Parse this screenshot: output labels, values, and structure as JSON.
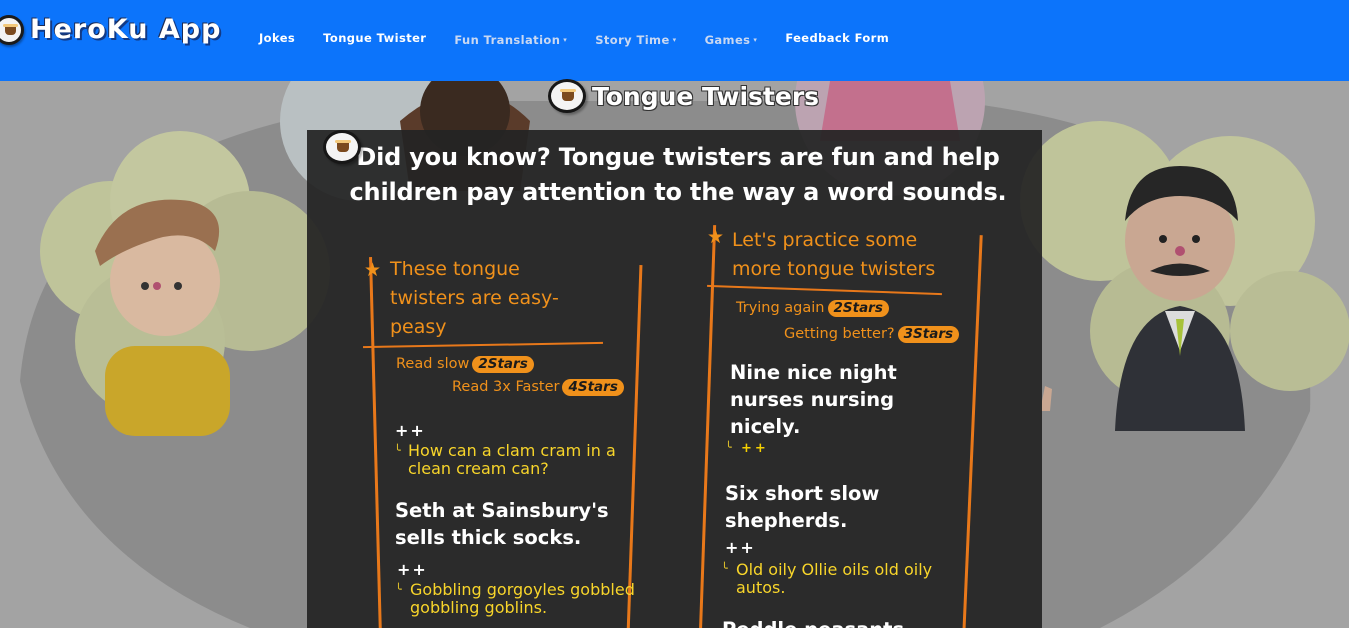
{
  "navbar": {
    "brand": "HeroKu App",
    "links": [
      {
        "label": "Jokes",
        "dropdown": false
      },
      {
        "label": "Tongue Twister",
        "dropdown": false
      },
      {
        "label": "Fun Translation",
        "dropdown": true
      },
      {
        "label": "Story Time",
        "dropdown": true
      },
      {
        "label": "Games",
        "dropdown": true
      },
      {
        "label": "Feedback Form",
        "dropdown": false
      }
    ],
    "caret": "▾"
  },
  "page": {
    "title": "Tongue Twisters"
  },
  "card": {
    "heading": "Did you know? Tongue twisters are fun and help children pay attention to the way a word sounds.",
    "left": {
      "title": "These tongue twisters are easy-peasy",
      "levels": [
        {
          "label": "Read slow",
          "badge": "2Stars"
        },
        {
          "label": "Read 3x Faster",
          "badge": "4Stars"
        }
      ],
      "items": [
        {
          "plus": "++",
          "text": "How can a clam cram in a clean cream can?"
        },
        {
          "text": "Seth at Sainsbury's sells thick socks.",
          "plus": "++",
          "subtext": "Gobbling gorgoyles gobbled gobbling goblins."
        }
      ]
    },
    "right": {
      "title": "Let's practice some more tongue twisters",
      "levels": [
        {
          "label": "Trying again",
          "badge": "2Stars"
        },
        {
          "label": "Getting better?",
          "badge": "3Stars"
        }
      ],
      "items": [
        {
          "text": "Nine nice night nurses nursing nicely.",
          "plus": "++"
        },
        {
          "text": "Six short slow shepherds.",
          "plus": "++",
          "subtext": "Old oily Ollie oils old oily autos."
        }
      ],
      "cutoff": "Peddle peasants"
    },
    "star_glyph": "★",
    "hook_glyph": "╰"
  },
  "colors": {
    "navbar": "#0c74fb",
    "accent": "#f0911b",
    "yellow": "#f8d52a",
    "card_bg": "#242424"
  }
}
